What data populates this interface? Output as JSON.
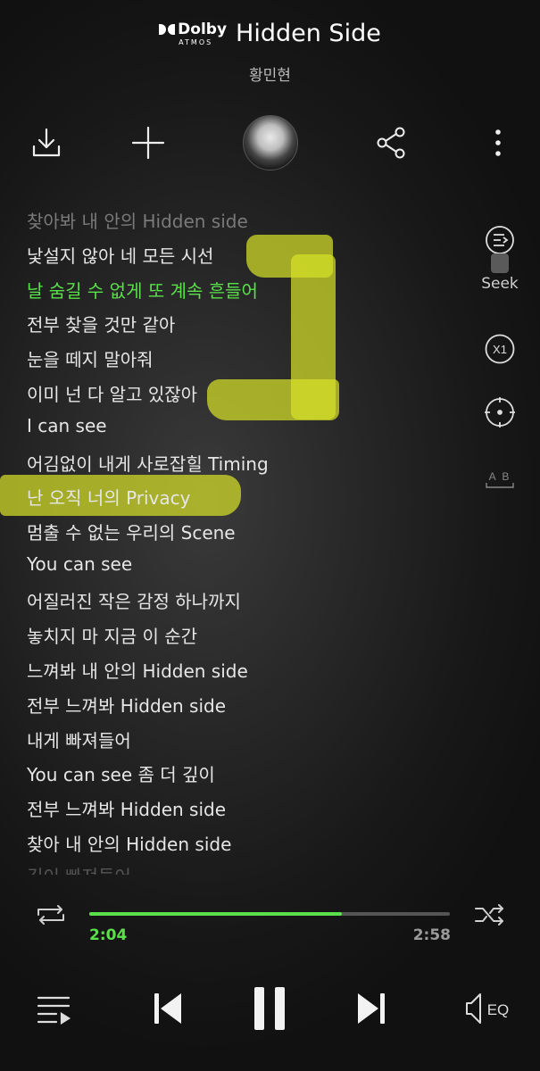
{
  "header": {
    "dolby_brand": "Dolby",
    "dolby_sub": "ATMOS",
    "title": "Hidden Side",
    "artist": "황민현"
  },
  "actions": [
    "download-icon",
    "add-icon",
    "album-avatar",
    "share-icon",
    "more-icon"
  ],
  "side_controls": {
    "seek_label": "Seek",
    "speed_label": "X1",
    "ab_label": "A B"
  },
  "lyrics": [
    "찾아봐 내 안의 Hidden side",
    "낯설지 않아 네 모든 시선",
    "날 숨길 수 없게 또 계속 흔들어",
    "전부 찾을 것만 같아",
    "눈을 떼지 말아줘",
    "이미 넌 다 알고 있잖아",
    "I can see",
    "어김없이 내게 사로잡힐 Timing",
    "난 오직 너의 Privacy",
    "멈출 수 없는 우리의 Scene",
    "You can see",
    "어질러진 작은 감정 하나까지",
    "놓치지 마 지금 이 순간",
    "느껴봐 내 안의 Hidden side",
    "전부 느껴봐 Hidden side",
    "내게 빠져들어",
    "You can see 좀 더 깊이",
    "전부 느껴봐 Hidden side",
    "찾아 내 안의 Hidden side",
    "깊이 빠져들어"
  ],
  "active_lyric_index": 2,
  "player": {
    "current_time": "2:04",
    "total_time": "2:58",
    "progress": 0.7,
    "eq_label": "EQ"
  },
  "colors": {
    "accent": "#5ae04a",
    "highlight": "#d6e028",
    "background": "#1a1a1a"
  }
}
